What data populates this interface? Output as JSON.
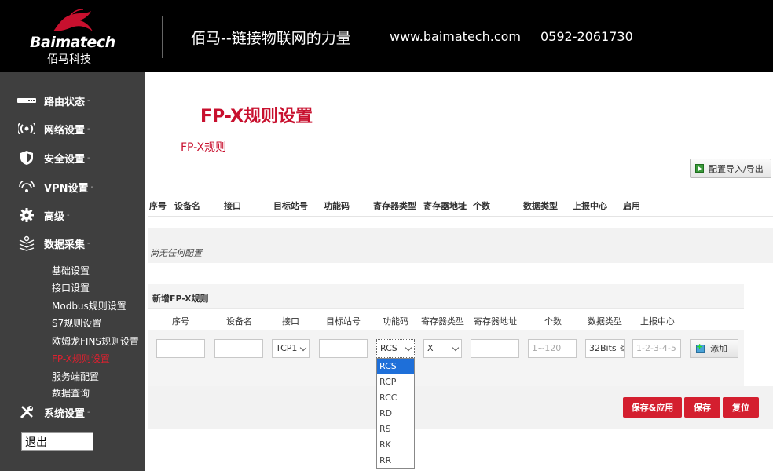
{
  "header": {
    "logo_en": "Baimatech",
    "logo_cn": "佰马科技",
    "slogan": "佰马--链接物联网的力量",
    "website": "www.baimatech.com",
    "phone": "0592-2061730"
  },
  "sidebar": {
    "items": [
      {
        "label": "路由状态",
        "icon": "router-icon"
      },
      {
        "label": "网络设置",
        "icon": "wireless-icon"
      },
      {
        "label": "安全设置",
        "icon": "shield-icon"
      },
      {
        "label": "VPN设置",
        "icon": "vpn-icon"
      },
      {
        "label": "高级",
        "icon": "gear-icon"
      },
      {
        "label": "数据采集",
        "icon": "data-collect-icon"
      }
    ],
    "sub_items": [
      {
        "label": "基础设置"
      },
      {
        "label": "接口设置"
      },
      {
        "label": "Modbus规则设置"
      },
      {
        "label": "S7规则设置"
      },
      {
        "label": "欧姆龙FINS规则设置"
      },
      {
        "label": "FP-X规则设置",
        "active": true
      },
      {
        "label": "服务端配置"
      },
      {
        "label": "数据查询"
      }
    ],
    "system": {
      "label": "系统设置",
      "icon": "tools-icon"
    },
    "arrow": "-",
    "logout": "退出"
  },
  "main": {
    "page_title": "FP-X规则设置",
    "section_title": "FP-X规则",
    "import_button": "配置导入/导出",
    "table_headers": [
      "序号",
      "设备名",
      "接口",
      "目标站号",
      "功能码",
      "寄存器类型",
      "寄存器地址",
      "个数",
      "数据类型",
      "上报中心",
      "启用"
    ],
    "empty_text": "尚无任何配置",
    "new_rule": {
      "title": "新增FP-X规则",
      "headers": [
        "序号",
        "设备名",
        "接口",
        "目标站号",
        "功能码",
        "寄存器类型",
        "寄存器地址",
        "个数",
        "数据类型",
        "上报中心"
      ],
      "interface_value": "TCP1",
      "function_value": "RCS",
      "register_type_value": "X",
      "count_placeholder": "1~120",
      "data_type_value": "32Bits ©",
      "report_placeholder": "1-2-3-4-5",
      "add_button": "添加"
    },
    "buttons": {
      "save_apply": "保存&应用",
      "save": "保存",
      "reset": "复位"
    },
    "dropdown_options": [
      "RCS",
      "RCP",
      "RCC",
      "RD",
      "RS",
      "RK",
      "RR"
    ]
  },
  "colors": {
    "accent": "#c8102e",
    "button_red": "#d41f2f",
    "sidebar_bg": "#3f3f3f",
    "selected_option": "#1e6fd9"
  }
}
